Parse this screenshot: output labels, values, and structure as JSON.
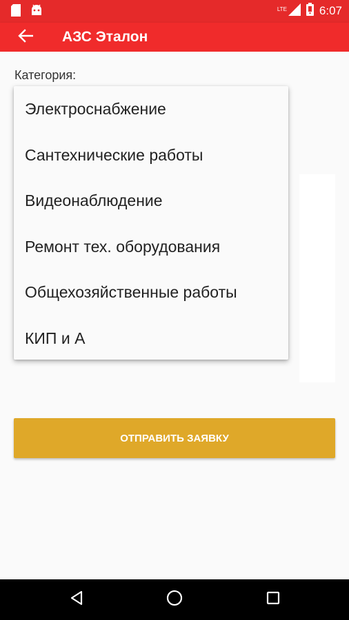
{
  "status_bar": {
    "time": "6:07",
    "network": "LTE",
    "icons": [
      "sd-card-icon",
      "android-icon",
      "signal-icon",
      "battery-icon"
    ]
  },
  "app_bar": {
    "title": "АЗС Эталон",
    "back_icon": "arrow-back-icon"
  },
  "form": {
    "category_label": "Категория:",
    "dropdown": {
      "options": [
        "Электроснабжение",
        "Сантехнические работы",
        "Видеонаблюдение",
        "Ремонт тех. оборудования",
        "Общехозяйственные работы",
        "КИП и А"
      ]
    },
    "submit_label": "ОТПРАВИТЬ ЗАЯВКУ"
  },
  "nav_bar": {
    "buttons": [
      "back-triangle-icon",
      "home-circle-icon",
      "recents-square-icon"
    ]
  },
  "colors": {
    "status_bar": "#e52a2a",
    "app_bar": "#f02b2b",
    "submit_button": "#dfa829",
    "background": "#fafafa"
  }
}
